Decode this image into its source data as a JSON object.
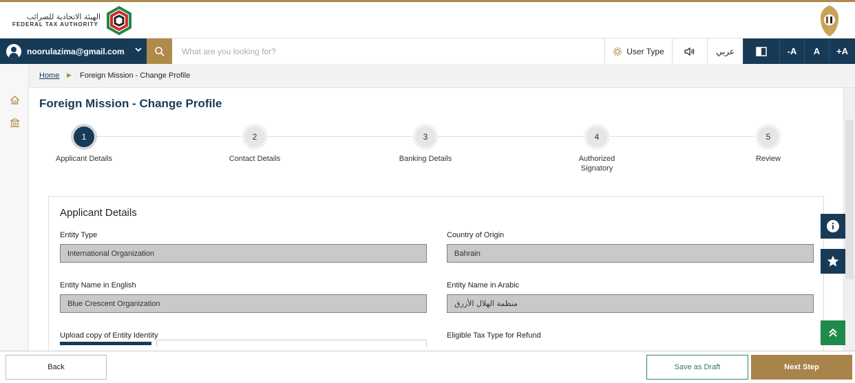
{
  "header": {
    "logo_arabic": "الهيئة الاتحادية للضرائب",
    "logo_english": "FEDERAL TAX AUTHORITY"
  },
  "navbar": {
    "user_email": "noorulazima@gmail.com",
    "search_placeholder": "What are you looking for?",
    "user_type_label": "User Type",
    "language_label": "عربي",
    "font_decrease_label": "-A",
    "font_reset_label": "A",
    "font_increase_label": "+A",
    "icons": [
      "user-avatar-icon",
      "chevron-down-icon",
      "search-icon",
      "gear-icon",
      "speaker-icon",
      "contrast-icon"
    ]
  },
  "sidebar": {
    "icons": [
      "home-icon",
      "bank-icon"
    ]
  },
  "breadcrumb": {
    "home": "Home",
    "current": "Foreign Mission - Change Profile"
  },
  "page": {
    "title": "Foreign Mission - Change Profile"
  },
  "stepper": {
    "steps": [
      {
        "number": "1",
        "label": "Applicant Details",
        "active": true
      },
      {
        "number": "2",
        "label": "Contact Details",
        "active": false
      },
      {
        "number": "3",
        "label": "Banking Details",
        "active": false
      },
      {
        "number": "4",
        "label": "Authorized Signatory",
        "active": false
      },
      {
        "number": "5",
        "label": "Review",
        "active": false
      }
    ]
  },
  "form": {
    "section_title": "Applicant Details",
    "entity_type_label": "Entity Type",
    "entity_type_value": "International Organization",
    "country_label": "Country of Origin",
    "country_value": "Bahrain",
    "name_en_label": "Entity Name in English",
    "name_en_value": "Blue Crescent Organization",
    "name_ar_label": "Entity Name in Arabic",
    "name_ar_value": "منظمة الهلال الأزرق",
    "upload_label": "Upload copy of Entity Identity",
    "tax_type_label": "Eligible Tax Type for Refund"
  },
  "floating": {
    "icons": [
      "info-icon",
      "star-icon",
      "scroll-top-icon"
    ]
  },
  "footer": {
    "back_label": "Back",
    "draft_label": "Save as Draft",
    "next_label": "Next Step"
  },
  "colors": {
    "navy": "#173a57",
    "gold": "#b08a4a",
    "green": "#2f8a62",
    "field_bg": "#c9c9c9"
  }
}
